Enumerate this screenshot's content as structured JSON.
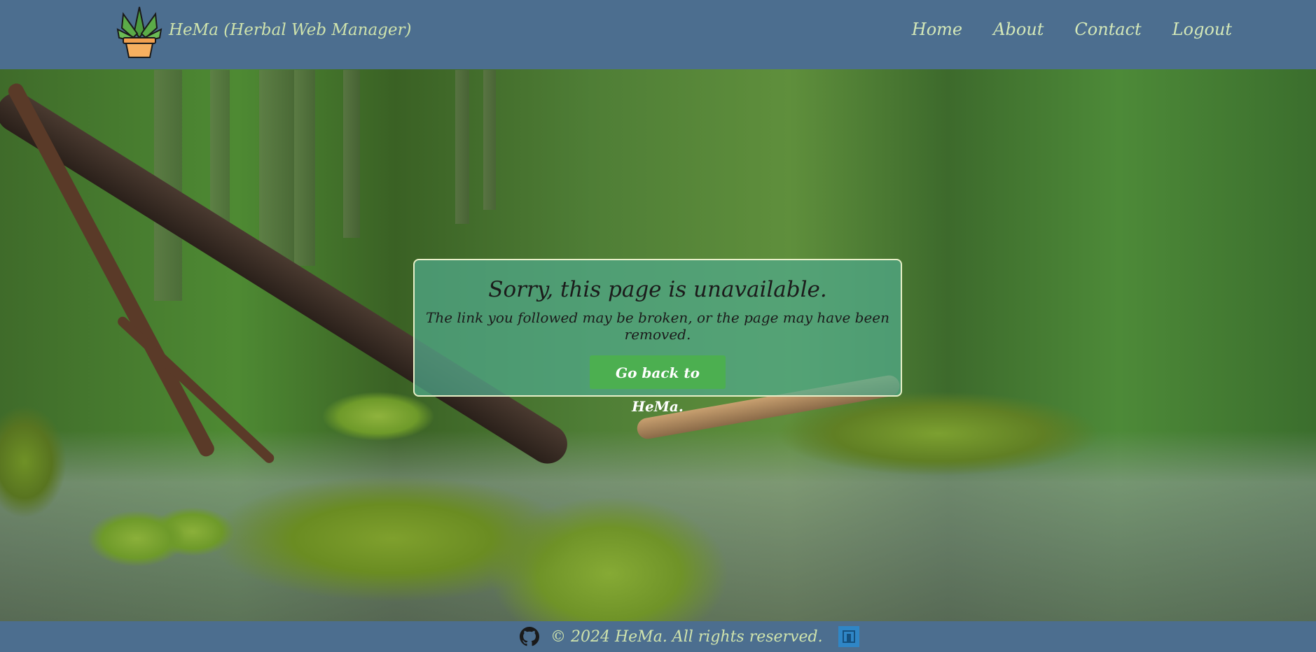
{
  "header": {
    "brand": "HeMa (Herbal Web Manager)",
    "nav": [
      {
        "label": "Home"
      },
      {
        "label": "About"
      },
      {
        "label": "Contact"
      },
      {
        "label": "Logout"
      }
    ]
  },
  "error_card": {
    "title": "Sorry, this page is unavailable.",
    "message": "The link you followed may be broken, or the page may have been removed.",
    "button_label": "Go back to HeMa."
  },
  "footer": {
    "copyright": "© 2024 HeMa. All rights reserved."
  },
  "icons": {
    "logo": "potted-plant-icon",
    "github": "github-icon",
    "footer_brand": "building-logo-icon"
  },
  "colors": {
    "header_bg": "#4c6e8f",
    "brand_text": "#cfe3ad",
    "card_bg": "#50aa8c",
    "button_bg": "#4caf50"
  }
}
